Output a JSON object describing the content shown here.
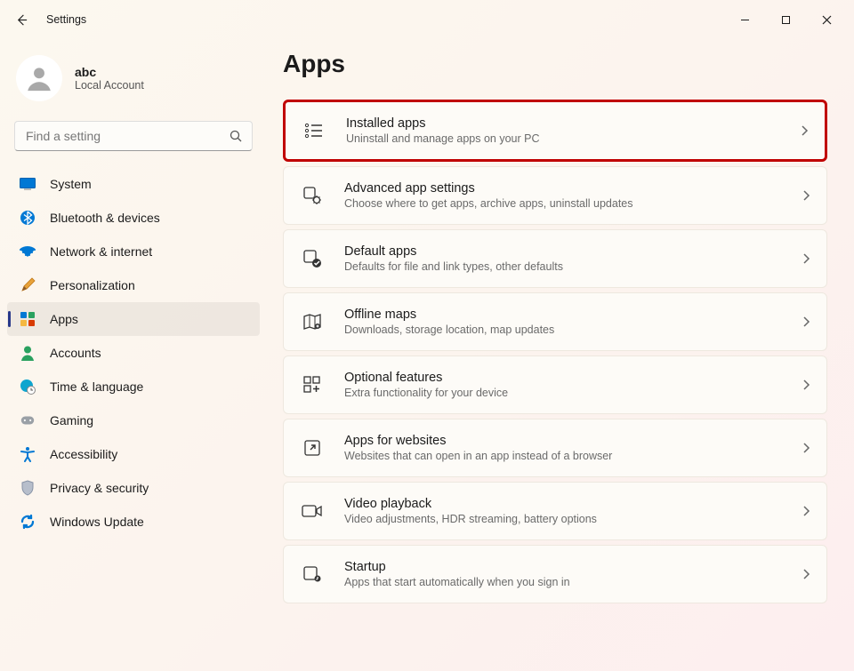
{
  "titlebar": {
    "title": "Settings"
  },
  "account": {
    "name": "abc",
    "sub": "Local Account"
  },
  "search": {
    "placeholder": "Find a setting"
  },
  "sidebar": {
    "items": [
      {
        "label": "System"
      },
      {
        "label": "Bluetooth & devices"
      },
      {
        "label": "Network & internet"
      },
      {
        "label": "Personalization"
      },
      {
        "label": "Apps"
      },
      {
        "label": "Accounts"
      },
      {
        "label": "Time & language"
      },
      {
        "label": "Gaming"
      },
      {
        "label": "Accessibility"
      },
      {
        "label": "Privacy & security"
      },
      {
        "label": "Windows Update"
      }
    ]
  },
  "page": {
    "title": "Apps"
  },
  "cards": [
    {
      "title": "Installed apps",
      "sub": "Uninstall and manage apps on your PC"
    },
    {
      "title": "Advanced app settings",
      "sub": "Choose where to get apps, archive apps, uninstall updates"
    },
    {
      "title": "Default apps",
      "sub": "Defaults for file and link types, other defaults"
    },
    {
      "title": "Offline maps",
      "sub": "Downloads, storage location, map updates"
    },
    {
      "title": "Optional features",
      "sub": "Extra functionality for your device"
    },
    {
      "title": "Apps for websites",
      "sub": "Websites that can open in an app instead of a browser"
    },
    {
      "title": "Video playback",
      "sub": "Video adjustments, HDR streaming, battery options"
    },
    {
      "title": "Startup",
      "sub": "Apps that start automatically when you sign in"
    }
  ]
}
